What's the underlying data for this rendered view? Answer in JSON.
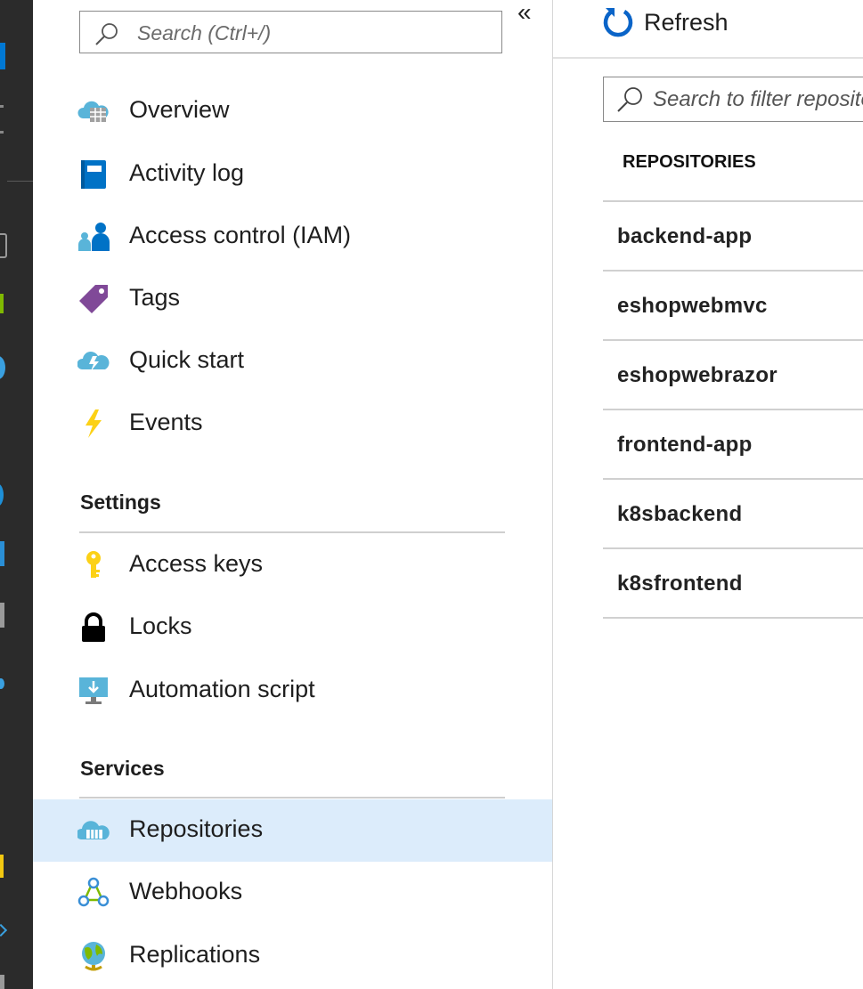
{
  "menu": {
    "search_placeholder": "Search (Ctrl+/)",
    "collapse_glyph": "«",
    "top_items": [
      {
        "label": "Overview",
        "icon": "overview-icon"
      },
      {
        "label": "Activity log",
        "icon": "activity-log-icon"
      },
      {
        "label": "Access control (IAM)",
        "icon": "access-control-icon"
      },
      {
        "label": "Tags",
        "icon": "tag-icon"
      },
      {
        "label": "Quick start",
        "icon": "quick-start-icon"
      },
      {
        "label": "Events",
        "icon": "lightning-icon"
      }
    ],
    "settings_header": "Settings",
    "settings_items": [
      {
        "label": "Access keys",
        "icon": "key-icon"
      },
      {
        "label": "Locks",
        "icon": "lock-icon"
      },
      {
        "label": "Automation script",
        "icon": "automation-script-icon"
      }
    ],
    "services_header": "Services",
    "services_items": [
      {
        "label": "Repositories",
        "icon": "repositories-icon",
        "selected": true
      },
      {
        "label": "Webhooks",
        "icon": "webhooks-icon"
      },
      {
        "label": "Replications",
        "icon": "globe-icon"
      }
    ]
  },
  "toolbar": {
    "refresh_label": "Refresh"
  },
  "repos": {
    "filter_placeholder": "Search to filter repositories...",
    "column_header": "REPOSITORIES",
    "items": [
      "backend-app",
      "eshopwebmvc",
      "eshopwebrazor",
      "frontend-app",
      "k8sbackend",
      "k8sfrontend"
    ]
  },
  "colors": {
    "selected_bg": "#dcecfb",
    "rail_bg": "#2b2b2b",
    "accent_blue": "#0a64c8"
  }
}
